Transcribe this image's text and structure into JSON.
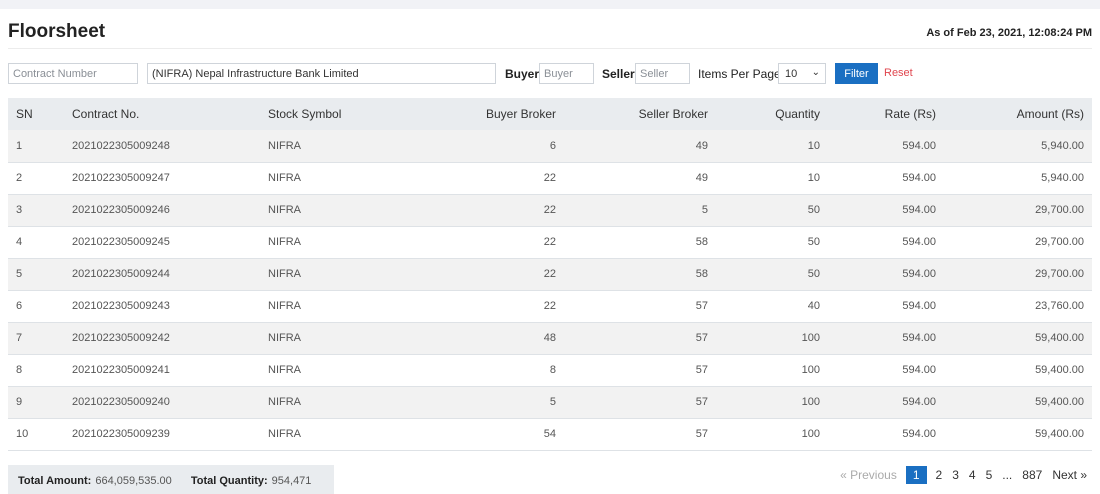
{
  "header": {
    "title": "Floorsheet",
    "as_of": "As of Feb 23, 2021, 12:08:24 PM"
  },
  "filters": {
    "contract_placeholder": "Contract Number",
    "company_value": "(NIFRA) Nepal Infrastructure Bank Limited",
    "buyer_label": "Buyer",
    "buyer_placeholder": "Buyer",
    "seller_label": "Seller",
    "seller_placeholder": "Seller",
    "items_label": "Items Per Page",
    "items_value": "10",
    "filter_label": "Filter",
    "reset_label": "Reset"
  },
  "table": {
    "columns": [
      "SN",
      "Contract No.",
      "Stock Symbol",
      "Buyer Broker",
      "Seller Broker",
      "Quantity",
      "Rate (Rs)",
      "Amount (Rs)"
    ],
    "rows": [
      [
        "1",
        "2021022305009248",
        "NIFRA",
        "6",
        "49",
        "10",
        "594.00",
        "5,940.00"
      ],
      [
        "2",
        "2021022305009247",
        "NIFRA",
        "22",
        "49",
        "10",
        "594.00",
        "5,940.00"
      ],
      [
        "3",
        "2021022305009246",
        "NIFRA",
        "22",
        "5",
        "50",
        "594.00",
        "29,700.00"
      ],
      [
        "4",
        "2021022305009245",
        "NIFRA",
        "22",
        "58",
        "50",
        "594.00",
        "29,700.00"
      ],
      [
        "5",
        "2021022305009244",
        "NIFRA",
        "22",
        "58",
        "50",
        "594.00",
        "29,700.00"
      ],
      [
        "6",
        "2021022305009243",
        "NIFRA",
        "22",
        "57",
        "40",
        "594.00",
        "23,760.00"
      ],
      [
        "7",
        "2021022305009242",
        "NIFRA",
        "48",
        "57",
        "100",
        "594.00",
        "59,400.00"
      ],
      [
        "8",
        "2021022305009241",
        "NIFRA",
        "8",
        "57",
        "100",
        "594.00",
        "59,400.00"
      ],
      [
        "9",
        "2021022305009240",
        "NIFRA",
        "5",
        "57",
        "100",
        "594.00",
        "59,400.00"
      ],
      [
        "10",
        "2021022305009239",
        "NIFRA",
        "54",
        "57",
        "100",
        "594.00",
        "59,400.00"
      ]
    ]
  },
  "totals": {
    "amount_label": "Total Amount:",
    "amount_value": "664,059,535.00",
    "quantity_label": "Total Quantity:",
    "quantity_value": "954,471"
  },
  "pagination": {
    "previous": "« Previous",
    "pages": [
      "1",
      "2",
      "3",
      "4",
      "5"
    ],
    "ellipsis": "...",
    "last": "887",
    "next": "Next »",
    "active": "1"
  },
  "colors": {
    "primary": "#1a6fc2",
    "reset": "#e0454e",
    "header_bg": "#e9ecef",
    "stripe": "#f2f2f2"
  }
}
